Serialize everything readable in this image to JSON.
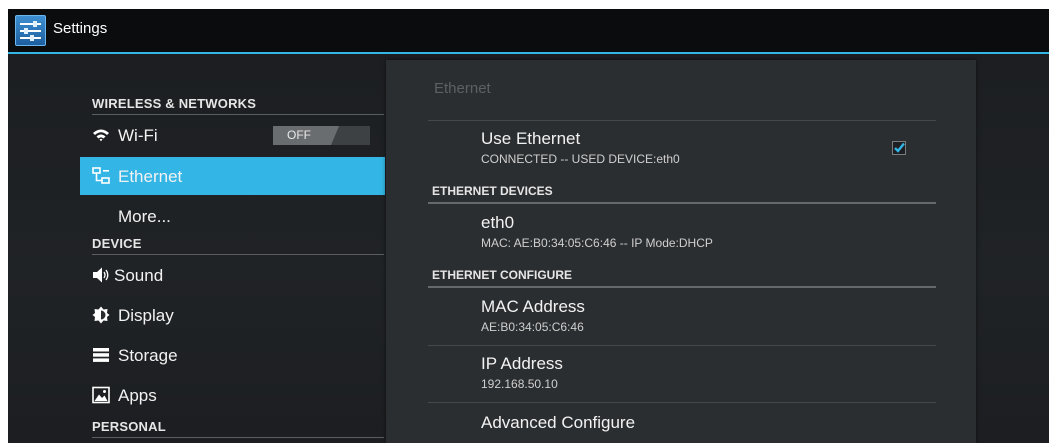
{
  "app": {
    "title": "Settings",
    "accent": "#33b5e5"
  },
  "menu": {
    "section_wireless": "WIRELESS & NETWORKS",
    "wifi": {
      "label": "Wi-Fi",
      "icon": "wifi-icon",
      "toggle": "OFF"
    },
    "ethernet": {
      "label": "Ethernet",
      "icon": "ethernet-icon"
    },
    "more": {
      "label": "More..."
    },
    "section_device": "DEVICE",
    "sound": {
      "label": "Sound",
      "icon": "speaker-icon"
    },
    "display": {
      "label": "Display",
      "icon": "brightness-icon"
    },
    "storage": {
      "label": "Storage",
      "icon": "storage-icon"
    },
    "apps": {
      "label": "Apps",
      "icon": "image-icon"
    },
    "section_personal": "PERSONAL"
  },
  "panel": {
    "title": "Ethernet",
    "use_ethernet": {
      "title": "Use Ethernet",
      "summary": "CONNECTED -- USED DEVICE:eth0",
      "checked": true
    },
    "devices_header": "ETHERNET DEVICES",
    "device": {
      "title": "eth0",
      "summary": "MAC: AE:B0:34:05:C6:46 -- IP Mode:DHCP"
    },
    "configure_header": "ETHERNET CONFIGURE",
    "mac": {
      "title": "MAC Address",
      "summary": "AE:B0:34:05:C6:46"
    },
    "ip": {
      "title": "IP Address",
      "summary": "192.168.50.10"
    },
    "advanced": {
      "title": "Advanced Configure"
    }
  }
}
